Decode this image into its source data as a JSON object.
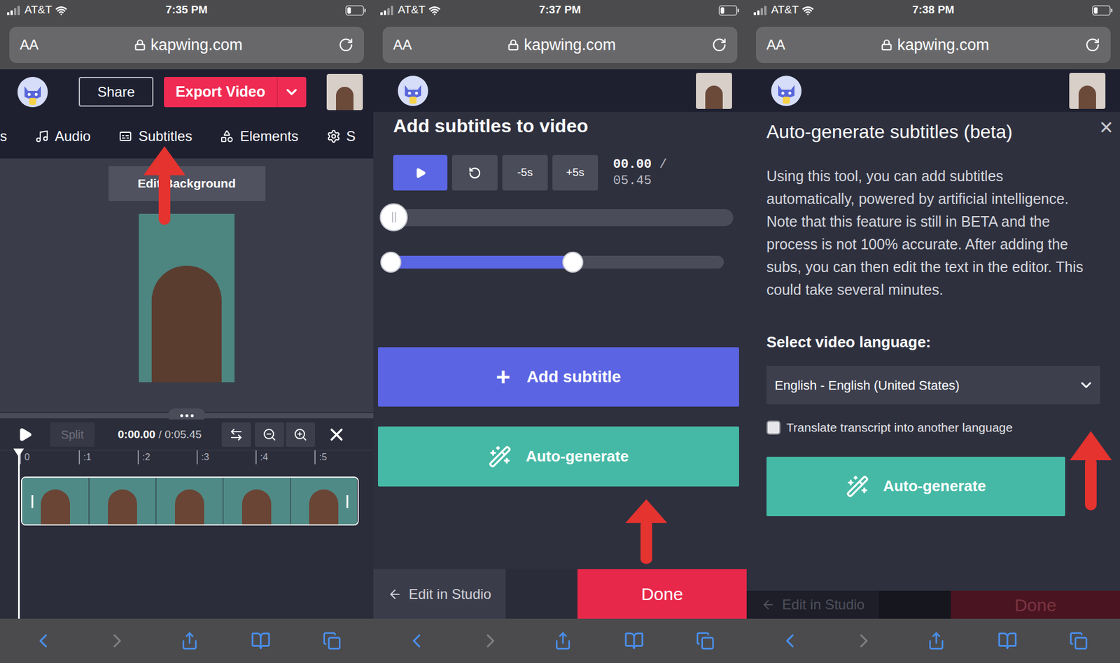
{
  "screens": [
    {
      "status": {
        "carrier": "AT&T",
        "time": "7:35 PM"
      },
      "address_bar": {
        "text_size": "AA",
        "url": "kapwing.com"
      },
      "toolbar": {
        "back_disabled": false,
        "forward_disabled": true
      }
    },
    {
      "status": {
        "carrier": "AT&T",
        "time": "7:37 PM"
      },
      "address_bar": {
        "text_size": "AA",
        "url": "kapwing.com"
      },
      "toolbar": {
        "back_disabled": false,
        "forward_disabled": true
      }
    },
    {
      "status": {
        "carrier": "AT&T",
        "time": "7:38 PM"
      },
      "address_bar": {
        "text_size": "AA",
        "url": "kapwing.com"
      },
      "toolbar": {
        "back_disabled": false,
        "forward_disabled": true
      }
    }
  ],
  "editor": {
    "header": {
      "share": "Share",
      "export": "Export Video"
    },
    "tabs": [
      {
        "label": "s",
        "selected": false
      },
      {
        "label": "Audio",
        "selected": false
      },
      {
        "label": "Subtitles",
        "selected": false
      },
      {
        "label": "Elements",
        "selected": false
      },
      {
        "label": "S",
        "selected": false
      }
    ],
    "canvas_button": "Edit Background",
    "timeline": {
      "split": "Split",
      "split_disabled": true,
      "time": "0:00.00",
      "separator": "/",
      "duration": "0:05.45",
      "ticks": [
        "0",
        ":1",
        ":2",
        ":3",
        ":4",
        ":5"
      ],
      "playhead": 0
    }
  },
  "subtitles": {
    "title": "Add subtitles to video",
    "controls": {
      "minus": "-5s",
      "plus": "+5s",
      "time": "00.00",
      "separator": "/",
      "duration": "05.45"
    },
    "scrubber": {
      "level": 0
    },
    "range": {
      "start": 0,
      "end": 0.56
    },
    "add_icon": "+",
    "add": "Add subtitle",
    "auto": "Auto-generate",
    "back": "Edit in Studio",
    "done": "Done"
  },
  "auto_generate": {
    "title": "Auto-generate subtitles (beta)",
    "close": "×",
    "description": "Using this tool, you can add subtitles automatically, powered by artificial intelligence. Note that this feature is still in BETA and the process is not 100% accurate. After adding the subs, you can then edit the text in the editor. This could take several minutes.",
    "language_label": "Select video language:",
    "language": "English - English (United States)",
    "translate": {
      "label": "Translate transcript into another language",
      "checked": false
    },
    "button": "Auto-generate",
    "behind": {
      "back": "Edit in Studio",
      "done": "Done"
    }
  }
}
